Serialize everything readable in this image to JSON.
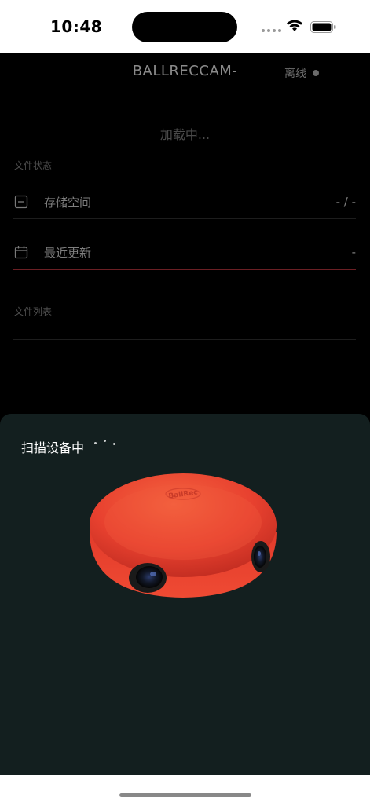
{
  "status_bar": {
    "time": "10:48",
    "icons": [
      "cellular-dots-icon",
      "wifi-icon",
      "battery-icon"
    ]
  },
  "header": {
    "device_title": "BALLRECCAM-",
    "connection_status": "离线"
  },
  "main": {
    "loading_text": "加载中...",
    "file_status_label": "文件状态",
    "rows": [
      {
        "icon": "storage-icon",
        "label": "存储空间",
        "value": "- / -"
      },
      {
        "icon": "calendar-icon",
        "label": "最近更新",
        "value": "-"
      }
    ],
    "file_list_label": "文件列表"
  },
  "sheet": {
    "scanning_text": "扫描设备中",
    "device_image": "ballrec-camera-image",
    "device_brand": "BallRec"
  },
  "colors": {
    "sheet_bg": "#131f1f",
    "accent_underline": "#6b1f24",
    "camera_red": "#e8412f"
  }
}
